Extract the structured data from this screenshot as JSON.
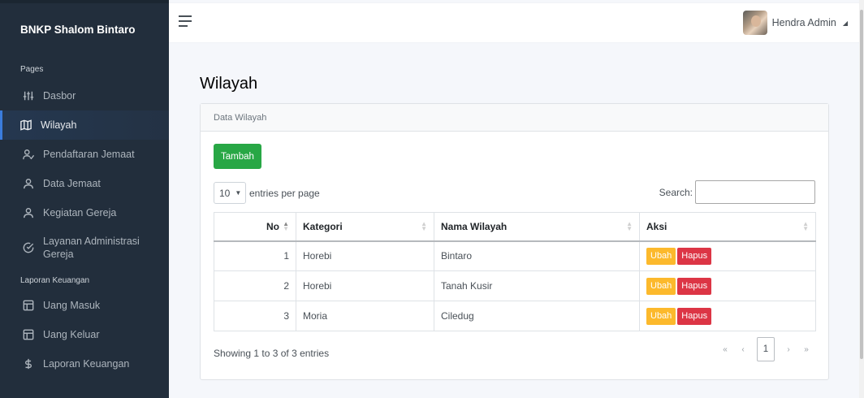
{
  "sidebar": {
    "brand": "BNKP Shalom Bintaro",
    "section_pages": "Pages",
    "section_laporan": "Laporan Keuangan",
    "pages_items": [
      {
        "label": "Dasbor",
        "icon": "sliders-icon"
      },
      {
        "label": "Wilayah",
        "icon": "map-icon",
        "active": true
      },
      {
        "label": "Pendaftaran Jemaat",
        "icon": "user-check-icon"
      },
      {
        "label": "Data Jemaat",
        "icon": "user-icon"
      },
      {
        "label": "Kegiatan Gereja",
        "icon": "user-icon"
      },
      {
        "label": "Layanan Administrasi Gereja",
        "icon": "check-circle-icon"
      }
    ],
    "laporan_items": [
      {
        "label": "Uang Masuk",
        "icon": "layout-icon"
      },
      {
        "label": "Uang Keluar",
        "icon": "layout-icon"
      },
      {
        "label": "Laporan Keuangan",
        "icon": "dollar-icon"
      }
    ]
  },
  "topbar": {
    "username": "Hendra Admin"
  },
  "main": {
    "title": "Wilayah",
    "card_title": "Data Wilayah",
    "add_button": "Tambah",
    "length_value": "10",
    "length_suffix": "entries per page",
    "search_label": "Search:",
    "search_value": "",
    "columns": [
      "No",
      "Kategori",
      "Nama Wilayah",
      "Aksi"
    ],
    "rows": [
      {
        "no": "1",
        "kategori": "Horebi",
        "nama": "Bintaro"
      },
      {
        "no": "2",
        "kategori": "Horebi",
        "nama": "Tanah Kusir"
      },
      {
        "no": "3",
        "kategori": "Moria",
        "nama": "Ciledug"
      }
    ],
    "edit_label": "Ubah",
    "delete_label": "Hapus",
    "info": "Showing 1 to 3 of 3 entries",
    "pager": {
      "first": "«",
      "prev": "‹",
      "current": "1",
      "next": "›",
      "last": "»"
    }
  },
  "colors": {
    "sidebar_bg": "#222e3c",
    "accent": "#3b7ddd",
    "success": "#28a745",
    "warning": "#fcb92c",
    "danger": "#dc3545"
  }
}
